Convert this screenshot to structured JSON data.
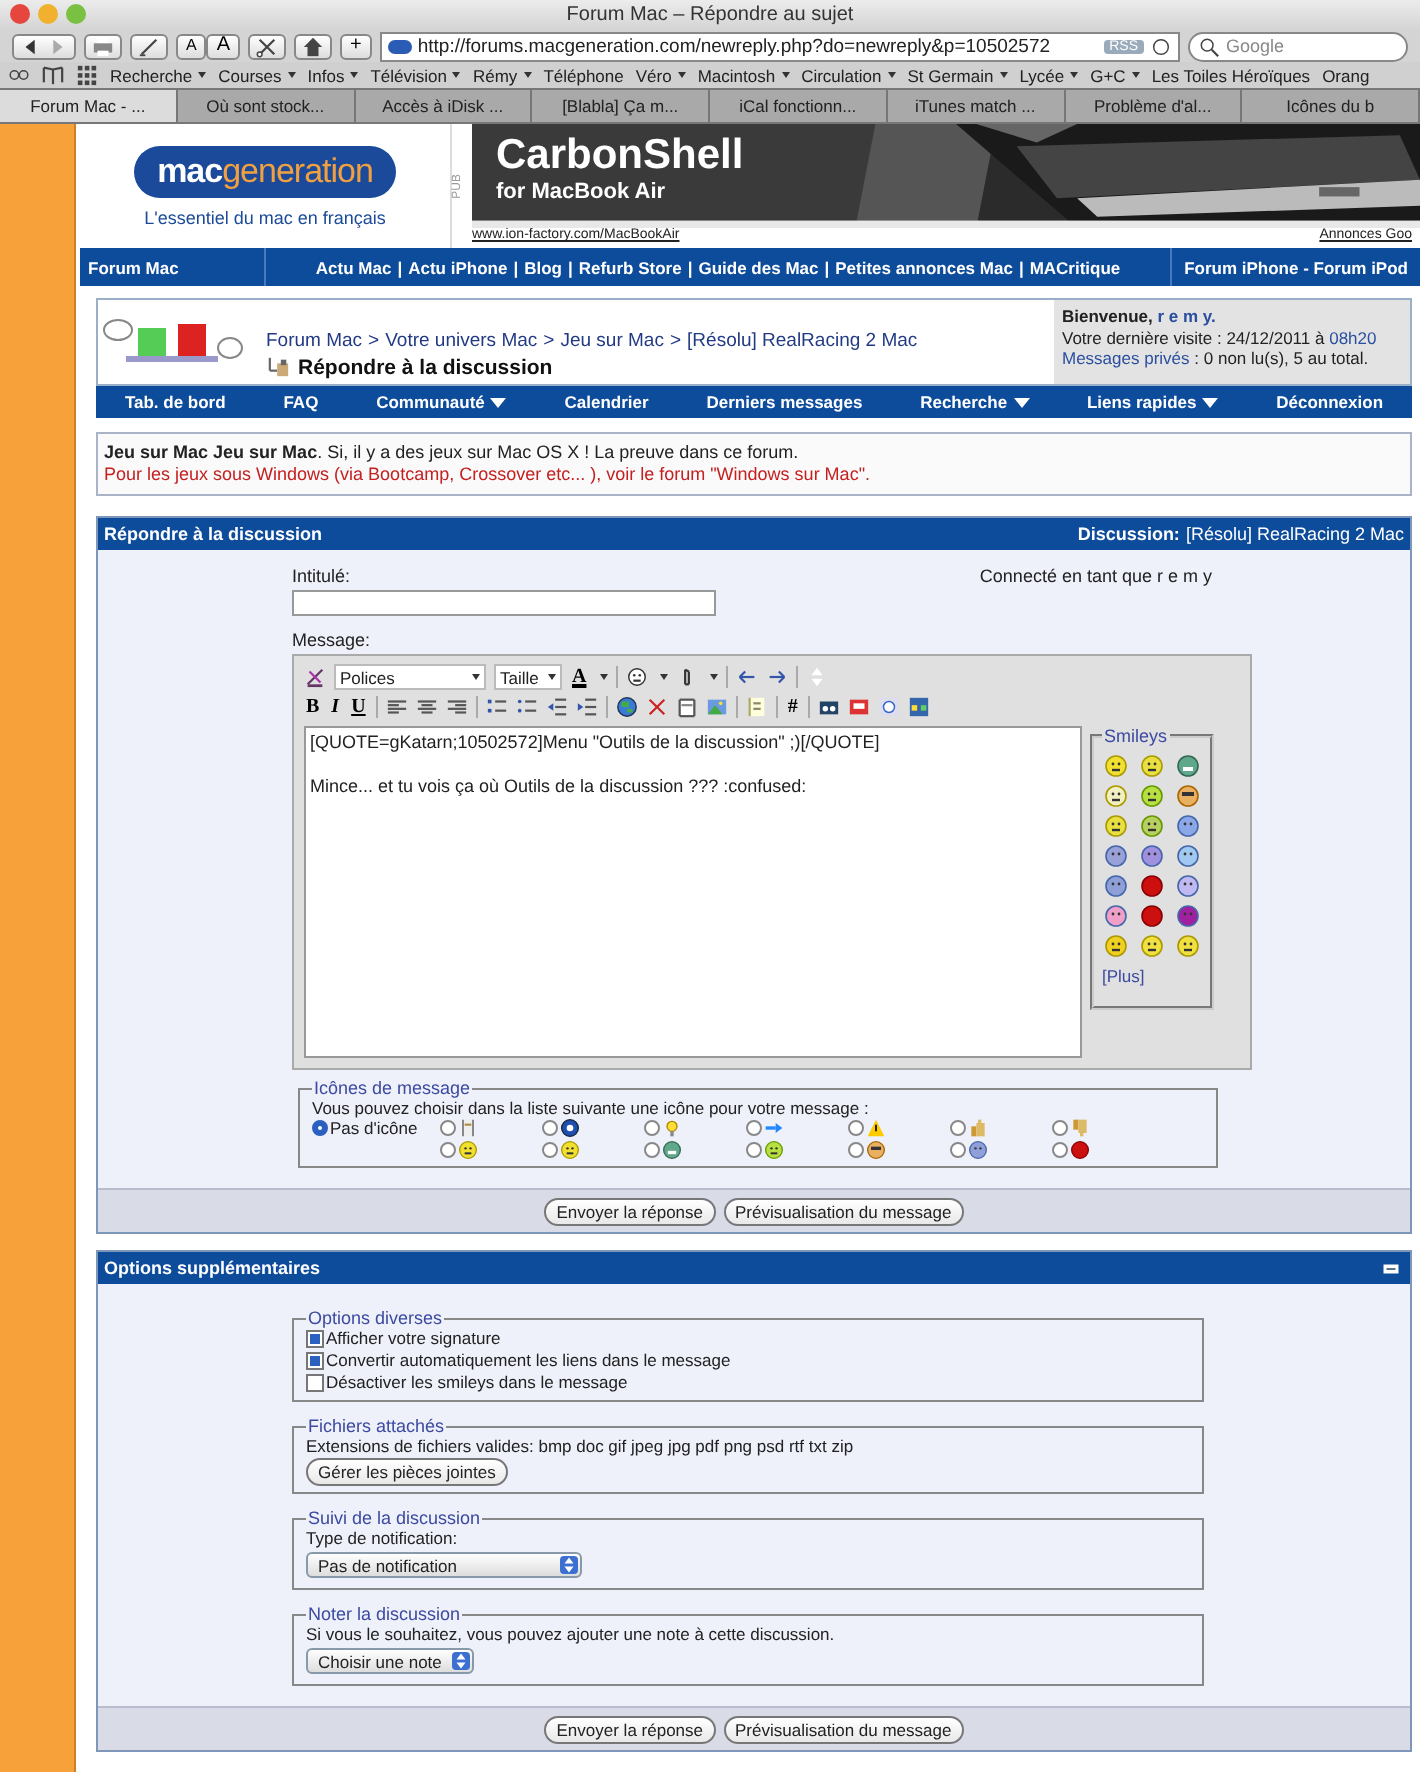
{
  "browser": {
    "title": "Forum Mac – Répondre au sujet",
    "url": "http://forums.macgeneration.com/newreply.php?do=newreply&p=10502572",
    "rss": "RSS",
    "search_placeholder": "Google",
    "font_buttons": [
      "A",
      "A"
    ],
    "add_button": "+",
    "bookmarks": [
      {
        "label": "Recherche",
        "menu": true
      },
      {
        "label": "Courses",
        "menu": true
      },
      {
        "label": "Infos",
        "menu": true
      },
      {
        "label": "Télévision",
        "menu": true
      },
      {
        "label": "Rémy",
        "menu": true
      },
      {
        "label": "Téléphone",
        "menu": false
      },
      {
        "label": "Véro",
        "menu": true
      },
      {
        "label": "Macintosh",
        "menu": true
      },
      {
        "label": "Circulation",
        "menu": true
      },
      {
        "label": "St Germain",
        "menu": true
      },
      {
        "label": "Lycée",
        "menu": true
      },
      {
        "label": "G+C",
        "menu": true
      },
      {
        "label": "Les Toiles Héroïques",
        "menu": false
      },
      {
        "label": "Orang",
        "menu": false
      }
    ],
    "tabs": [
      {
        "label": "Forum Mac - ...",
        "selected": true
      },
      {
        "label": "Où sont stock...",
        "selected": false
      },
      {
        "label": "Accès à iDisk ...",
        "selected": false
      },
      {
        "label": "[Blabla] Ça m...",
        "selected": false
      },
      {
        "label": "iCal fonctionn...",
        "selected": false
      },
      {
        "label": "iTunes match ...",
        "selected": false
      },
      {
        "label": "Problème d'al...",
        "selected": false
      },
      {
        "label": "Icônes du b",
        "selected": false
      }
    ]
  },
  "header": {
    "logo": {
      "part1": "mac",
      "part2": "generation"
    },
    "tagline": "L'essentiel du mac en français",
    "ad": {
      "label": "PUB",
      "headline": "CarbonShell",
      "subline": "for MacBook Air",
      "link": "www.ion-factory.com/MacBookAir",
      "sponsor": "Annonces Goo"
    }
  },
  "top_nav": {
    "left": "Forum Mac",
    "separator": "|",
    "links": [
      "Actu Mac",
      "Actu iPhone",
      "Blog",
      "Refurb Store",
      "Guide des Mac",
      "Petites annonces Mac",
      "MACritique"
    ],
    "right": "Forum iPhone - Forum iPod"
  },
  "breadcrumb": {
    "separator": ">",
    "items": [
      "Forum Mac",
      "Votre univers Mac",
      "Jeu sur Mac",
      "[Résolu] RealRacing 2 Mac"
    ],
    "title": "Répondre à la discussion"
  },
  "user_box": {
    "welcome": "Bienvenue,",
    "username": "r e m y.",
    "last_visit": "Votre dernière visite : 24/12/2011 à",
    "last_visit_time": "08h20",
    "pm_link": "Messages privés",
    "pm_text": ": 0 non lu(s), 5 au total."
  },
  "main_nav": [
    {
      "label": "Tab. de bord",
      "menu": false
    },
    {
      "label": "FAQ",
      "menu": false
    },
    {
      "label": "Communauté",
      "menu": true
    },
    {
      "label": "Calendrier",
      "menu": false
    },
    {
      "label": "Derniers messages",
      "menu": false
    },
    {
      "label": "Recherche",
      "menu": true
    },
    {
      "label": "Liens rapides",
      "menu": true
    },
    {
      "label": "Déconnexion",
      "menu": false
    }
  ],
  "notice": {
    "text": "**Jeu sur Mac** **Jeu sur Mac**. Si, il y a des jeux sur Mac OS X ! La preuve dans ce forum.",
    "warning": "Pour les jeux sous Windows (via Bootcamp, Crossover etc... ), voir le forum \"Windows sur Mac\"."
  },
  "reply_panel": {
    "title": "Répondre à la discussion",
    "discussion_label": "Discussion:",
    "discussion_link": "[Résolu] RealRacing 2 Mac",
    "subject_label": "Intitulé:",
    "logged_in": "Connecté en tant que r e m y",
    "message_label": "Message:",
    "editor": {
      "font_select": "Polices",
      "size_select": "Taille",
      "color_button": "A",
      "bold": "B",
      "italic": "I",
      "underline": "U",
      "hash": "#",
      "content": [
        "[QUOTE=gKatarn;10502572]Menu \"Outils de la discussion\" ;)[/QUOTE]",
        "Mince... et tu vois ça où Outils de la discussion ??? :confused:"
      ]
    },
    "smileys": {
      "title": "Smileys",
      "more": "[Plus]"
    },
    "message_icons": {
      "title": "Icônes de message",
      "prompt": "Vous pouvez choisir dans la liste suivante une icône pour votre message :",
      "options": [
        {
          "label": "Pas d'icône",
          "selected": true
        },
        {
          "selected": false
        },
        {
          "selected": false
        },
        {
          "selected": false
        },
        {
          "selected": false
        },
        {
          "selected": false
        },
        {
          "selected": false
        },
        {
          "selected": false
        },
        {
          "selected": false
        },
        {
          "selected": false
        },
        {
          "selected": false
        },
        {
          "selected": false
        },
        {
          "selected": false
        },
        {
          "selected": false
        },
        {
          "selected": false
        }
      ]
    },
    "buttons": [
      "Envoyer la réponse",
      "Prévisualisation du message"
    ]
  },
  "options_panel": {
    "title": "Options supplémentaires",
    "groups": [
      {
        "kind": "checkboxes",
        "title": "Options diverses",
        "items": [
          {
            "label": "Afficher votre signature",
            "checked": true
          },
          {
            "label": "Convertir automatiquement les liens dans le message",
            "checked": true
          },
          {
            "label": "Désactiver les smileys dans le message",
            "checked": false
          }
        ]
      },
      {
        "kind": "attachments",
        "title": "Fichiers attachés",
        "text": "Extensions de fichiers valides: bmp doc gif jpeg jpg pdf png psd rtf txt zip",
        "button": "Gérer les pièces jointes"
      },
      {
        "kind": "select",
        "title": "Suivi de la discussion",
        "label": "Type de notification:",
        "value": "Pas de notification"
      },
      {
        "kind": "select",
        "title": "Noter la discussion",
        "label": "Si vous le souhaitez, vous pouvez ajouter une note à cette discussion.",
        "value": "Choisir une note"
      }
    ],
    "buttons": [
      "Envoyer la réponse",
      "Prévisualisation du message"
    ]
  }
}
